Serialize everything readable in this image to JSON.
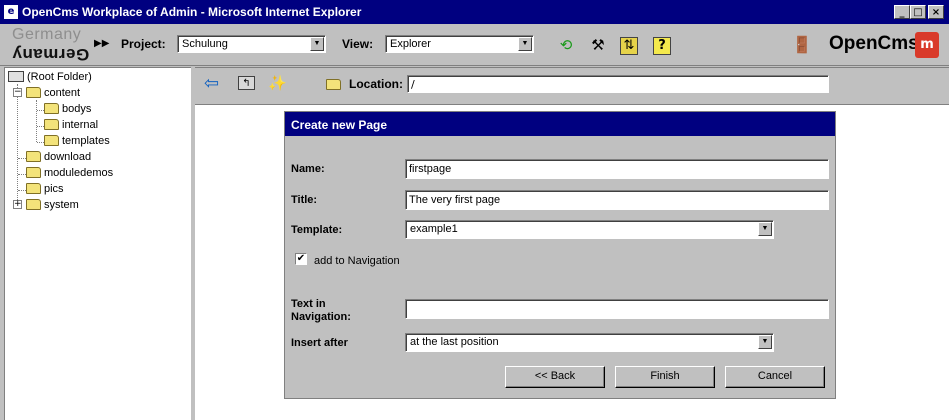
{
  "window": {
    "title": "OpenCms Workplace of Admin - Microsoft Internet Explorer",
    "controls": [
      "_",
      "□",
      "×"
    ]
  },
  "toolbar": {
    "logo_top": "Germany",
    "logo_bottom": "Germany",
    "project_label": "Project:",
    "project_value": "Schulung",
    "view_label": "View:",
    "view_value": "Explorer",
    "icons": [
      "publish-icon",
      "tools-icon",
      "sync-icon",
      "help-icon"
    ],
    "brand": "OpenCms",
    "brand_mark": "m"
  },
  "tree": {
    "root": "(Root Folder)",
    "items": [
      {
        "label": "content"
      },
      {
        "label": "bodys"
      },
      {
        "label": "internal"
      },
      {
        "label": "templates"
      },
      {
        "label": "download"
      },
      {
        "label": "moduledemos"
      },
      {
        "label": "pics"
      },
      {
        "label": "system"
      }
    ]
  },
  "navbar": {
    "location_label": "Location:",
    "location_value": "/"
  },
  "dialog": {
    "title": "Create new Page",
    "name_label": "Name:",
    "name_value": "firstpage",
    "title_label": "Title:",
    "title_value": "The very first page",
    "template_label": "Template:",
    "template_value": "example1",
    "add_nav_label": "add to Navigation",
    "add_nav_checked": true,
    "text_nav_label_1": "Text in",
    "text_nav_label_2": "Navigation:",
    "text_nav_value": "",
    "insert_after_label": "Insert after",
    "insert_after_value": "at the last position",
    "back_button": "<< Back",
    "finish_button": "Finish",
    "cancel_button": "Cancel"
  }
}
